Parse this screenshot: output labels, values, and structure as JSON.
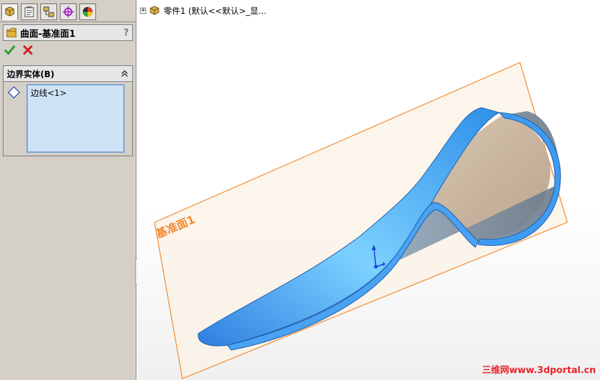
{
  "panel": {
    "tabs": [
      {
        "icon": "feature-manager-icon",
        "active": true
      },
      {
        "icon": "property-manager-icon",
        "active": false
      },
      {
        "icon": "configuration-manager-icon",
        "active": false
      },
      {
        "icon": "dimxpert-manager-icon",
        "active": false
      },
      {
        "icon": "display-manager-icon",
        "active": false
      }
    ],
    "title": "曲面-基准面1",
    "help_label": "?",
    "ok_icon": "checkmark-icon",
    "cancel_icon": "x-icon",
    "group": {
      "title": "边界实体(B)",
      "collapse_icon": "double-chevron-up-icon",
      "selection_icon": "diamond-icon",
      "items": [
        "边线<1>"
      ]
    }
  },
  "tree": {
    "expand_label": "+",
    "part_label": "零件1 (默认<<默认>_显..."
  },
  "viewport": {
    "plane_label": "基准面1",
    "watermark": "三维网www.3dportal.cn",
    "colors": {
      "surface_blue": "#3f9bf0",
      "plane_orange": "#f28a30",
      "patch_tan": "#cdbaa4"
    }
  }
}
